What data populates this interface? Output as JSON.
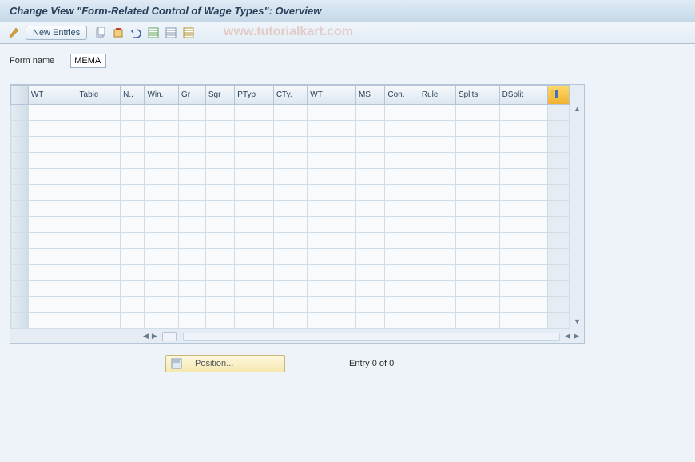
{
  "title": "Change View \"Form-Related Control of Wage Types\": Overview",
  "toolbar": {
    "new_entries": "New Entries"
  },
  "watermark": "www.tutorialkart.com",
  "form": {
    "label": "Form name",
    "value": "MEMA"
  },
  "table": {
    "columns": [
      "WT",
      "Table",
      "N..",
      "Win.",
      "Gr",
      "Sgr",
      "PTyp",
      "CTy.",
      "WT",
      "MS",
      "Con.",
      "Rule",
      "Splits",
      "DSplit"
    ]
  },
  "footer": {
    "position": "Position...",
    "entry": "Entry 0 of 0"
  }
}
